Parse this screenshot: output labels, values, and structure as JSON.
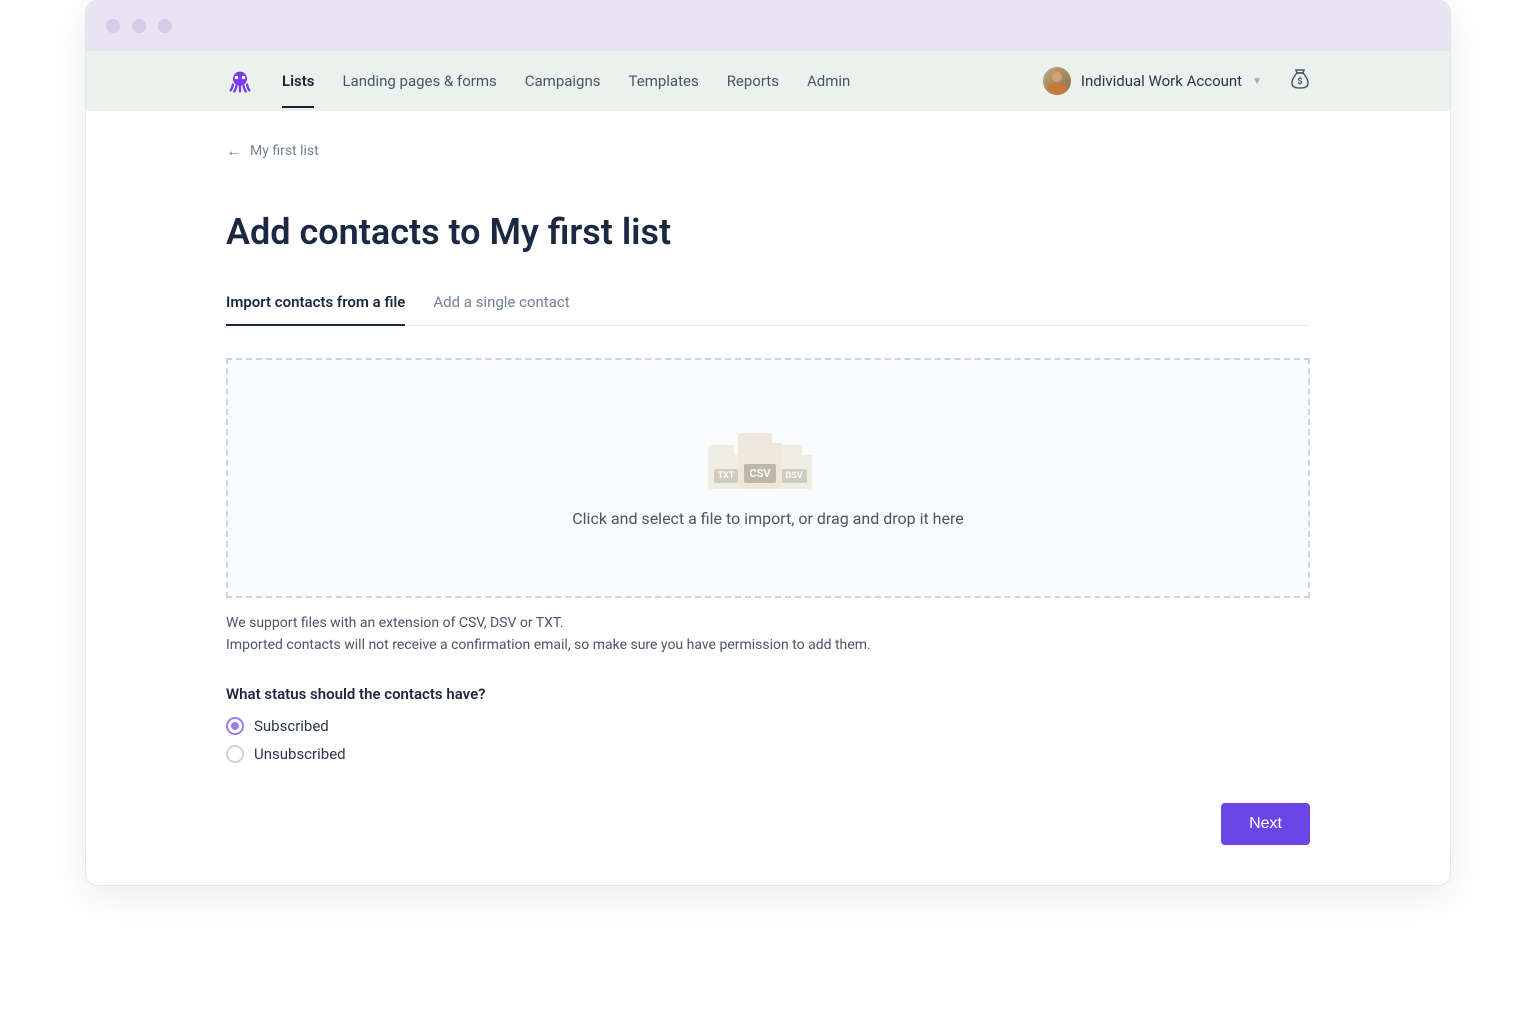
{
  "nav": {
    "items": [
      "Lists",
      "Landing pages & forms",
      "Campaigns",
      "Templates",
      "Reports",
      "Admin"
    ],
    "active_index": 0
  },
  "account": {
    "name": "Individual Work Account"
  },
  "breadcrumb": {
    "label": "My first list"
  },
  "page": {
    "title": "Add contacts to My first list"
  },
  "tabs": {
    "items": [
      "Import contacts from a file",
      "Add a single contact"
    ],
    "active_index": 0
  },
  "dropzone": {
    "file_types": [
      "TXT",
      "CSV",
      "DSV"
    ],
    "instruction": "Click and select a file to import, or drag and drop it here"
  },
  "help": {
    "line1": "We support files with an extension of CSV, DSV or TXT.",
    "line2": "Imported contacts will not receive a confirmation email, so make sure you have permission to add them."
  },
  "status": {
    "label": "What status should the contacts have?",
    "options": [
      "Subscribed",
      "Unsubscribed"
    ],
    "selected_index": 0
  },
  "actions": {
    "next": "Next"
  }
}
